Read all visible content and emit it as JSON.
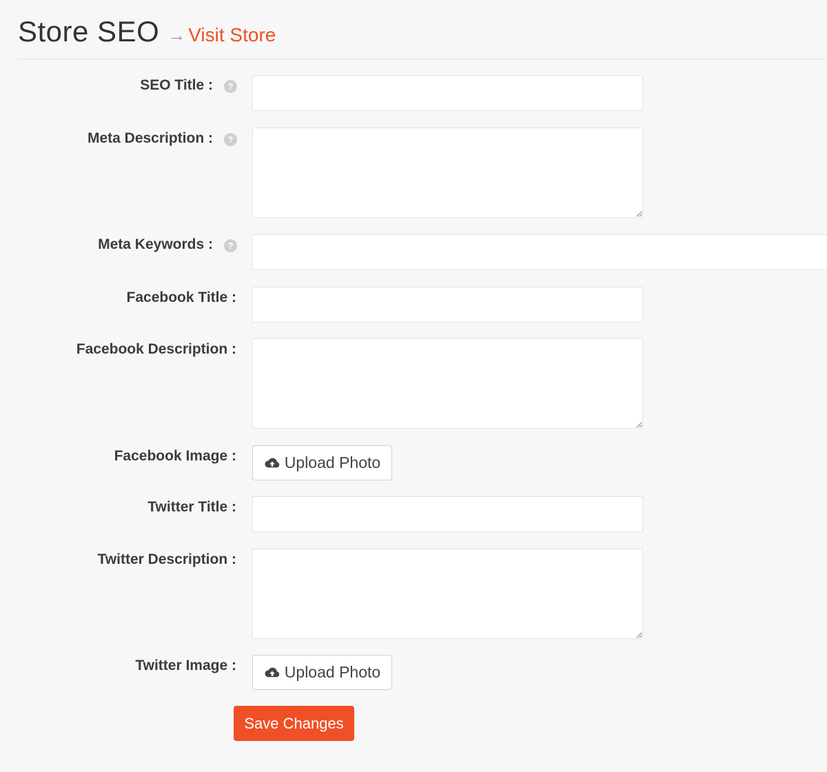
{
  "header": {
    "title": "Store SEO",
    "arrow": "→",
    "visit_link": "Visit Store"
  },
  "form": {
    "seo_title": {
      "label": "SEO Title :",
      "value": ""
    },
    "meta_description": {
      "label": "Meta Description :",
      "value": ""
    },
    "meta_keywords": {
      "label": "Meta Keywords :",
      "value": ""
    },
    "facebook_title": {
      "label": "Facebook Title :",
      "value": ""
    },
    "facebook_description": {
      "label": "Facebook Description :",
      "value": ""
    },
    "facebook_image": {
      "label": "Facebook Image :",
      "button": "Upload Photo"
    },
    "twitter_title": {
      "label": "Twitter Title :",
      "value": ""
    },
    "twitter_description": {
      "label": "Twitter Description :",
      "value": ""
    },
    "twitter_image": {
      "label": "Twitter Image :",
      "button": "Upload Photo"
    },
    "help_icon": "?",
    "save_button": "Save Changes"
  },
  "colors": {
    "accent": "#f05025",
    "background": "#f7f7f7",
    "label": "#3c3c3c",
    "help_icon": "#cfcfcf"
  },
  "icons": {
    "help": "question-circle-icon",
    "upload": "cloud-upload-icon"
  }
}
